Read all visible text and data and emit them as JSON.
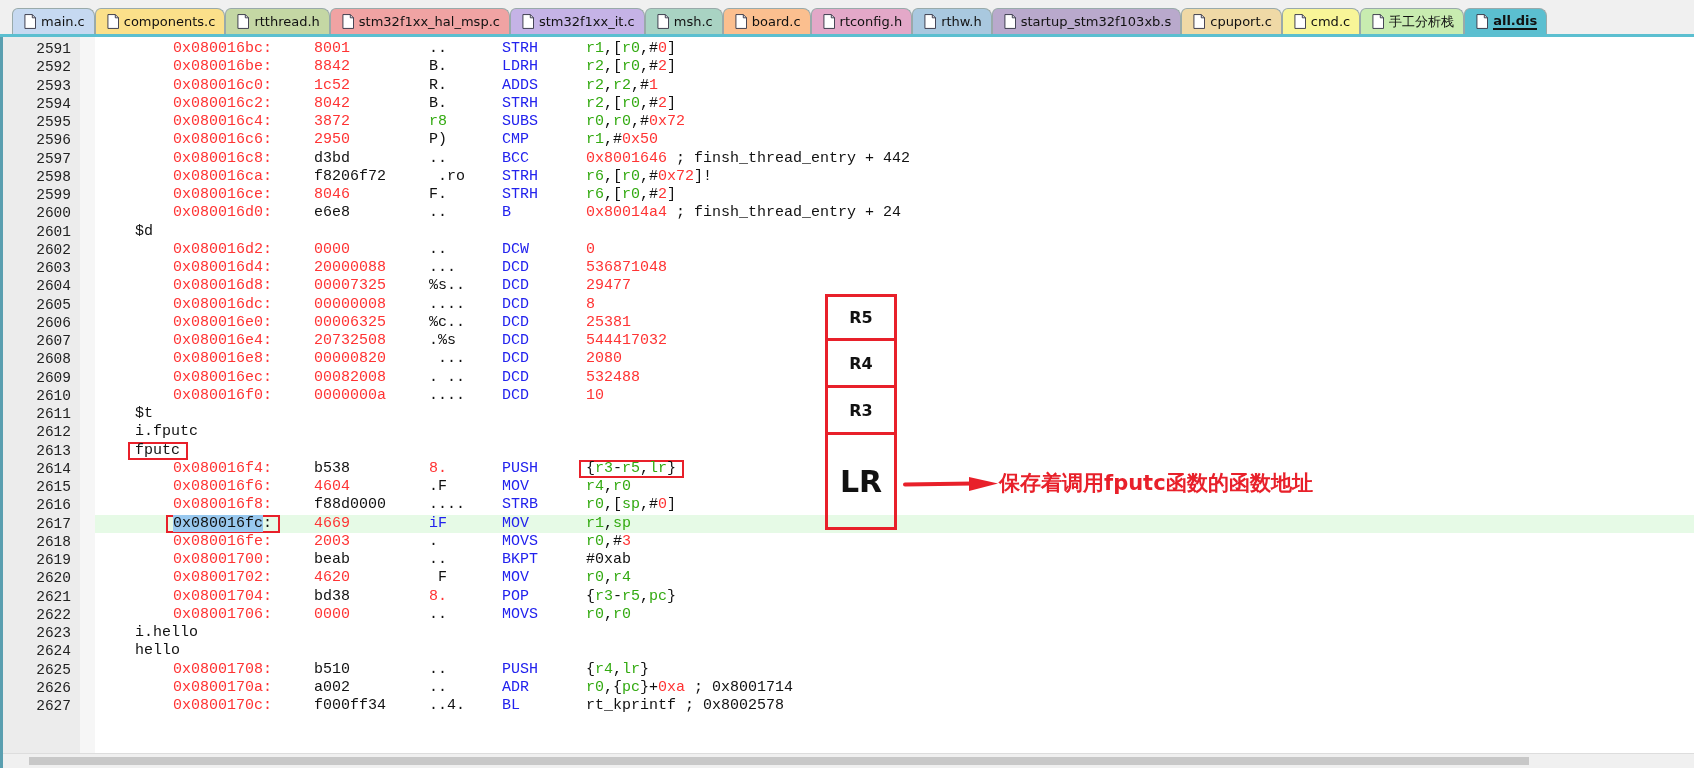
{
  "tabs": [
    {
      "label": "main.c",
      "color": "#c6d9f1",
      "selected": false
    },
    {
      "label": "components.c",
      "color": "#fbe08a",
      "selected": false
    },
    {
      "label": "rtthread.h",
      "color": "#c4d7a4",
      "selected": false
    },
    {
      "label": "stm32f1xx_hal_msp.c",
      "color": "#f0a3a3",
      "selected": false
    },
    {
      "label": "stm32f1xx_it.c",
      "color": "#c5b3e6",
      "selected": false
    },
    {
      "label": "msh.c",
      "color": "#a9d3c3",
      "selected": false
    },
    {
      "label": "board.c",
      "color": "#fbbf8f",
      "selected": false
    },
    {
      "label": "rtconfig.h",
      "color": "#e3a8c8",
      "selected": false
    },
    {
      "label": "rthw.h",
      "color": "#a9c8df",
      "selected": false
    },
    {
      "label": "startup_stm32f103xb.s",
      "color": "#b9a9cc",
      "selected": false
    },
    {
      "label": "cpuport.c",
      "color": "#efd9a6",
      "selected": false
    },
    {
      "label": "cmd.c",
      "color": "#f8f598",
      "selected": false
    },
    {
      "label": "手工分析栈",
      "color": "#c8ecb0",
      "selected": false
    },
    {
      "label": "all.dis",
      "color": "#5bbfd0",
      "selected": true
    }
  ],
  "lines": [
    {
      "num": "2591",
      "kind": "instr",
      "addr": "0x080016bc:",
      "hex": {
        "text": "8001",
        "kind": "num"
      },
      "ascii": {
        "text": "..",
        "kind": "txt"
      },
      "op": "STRH",
      "args": [
        {
          "text": "r1",
          "kind": "reg"
        },
        {
          "text": ",[",
          "kind": "txt"
        },
        {
          "text": "r0",
          "kind": "reg"
        },
        {
          "text": ",#",
          "kind": "txt"
        },
        {
          "text": "0",
          "kind": "num"
        },
        {
          "text": "]",
          "kind": "txt"
        }
      ]
    },
    {
      "num": "2592",
      "kind": "instr",
      "addr": "0x080016be:",
      "hex": {
        "text": "8842",
        "kind": "num"
      },
      "ascii": {
        "text": "B.",
        "kind": "txt"
      },
      "op": "LDRH",
      "args": [
        {
          "text": "r2",
          "kind": "reg"
        },
        {
          "text": ",[",
          "kind": "txt"
        },
        {
          "text": "r0",
          "kind": "reg"
        },
        {
          "text": ",#",
          "kind": "txt"
        },
        {
          "text": "2",
          "kind": "num"
        },
        {
          "text": "]",
          "kind": "txt"
        }
      ]
    },
    {
      "num": "2593",
      "kind": "instr",
      "addr": "0x080016c0:",
      "hex": {
        "text": "1c52",
        "kind": "num"
      },
      "ascii": {
        "text": "R.",
        "kind": "txt"
      },
      "op": "ADDS",
      "args": [
        {
          "text": "r2",
          "kind": "reg"
        },
        {
          "text": ",",
          "kind": "txt"
        },
        {
          "text": "r2",
          "kind": "reg"
        },
        {
          "text": ",#",
          "kind": "txt"
        },
        {
          "text": "1",
          "kind": "num"
        }
      ]
    },
    {
      "num": "2594",
      "kind": "instr",
      "addr": "0x080016c2:",
      "hex": {
        "text": "8042",
        "kind": "num"
      },
      "ascii": {
        "text": "B.",
        "kind": "txt"
      },
      "op": "STRH",
      "args": [
        {
          "text": "r2",
          "kind": "reg"
        },
        {
          "text": ",[",
          "kind": "txt"
        },
        {
          "text": "r0",
          "kind": "reg"
        },
        {
          "text": ",#",
          "kind": "txt"
        },
        {
          "text": "2",
          "kind": "num"
        },
        {
          "text": "]",
          "kind": "txt"
        }
      ]
    },
    {
      "num": "2595",
      "kind": "instr",
      "addr": "0x080016c4:",
      "hex": {
        "text": "3872",
        "kind": "num"
      },
      "ascii": {
        "text": "r8",
        "kind": "reg"
      },
      "op": "SUBS",
      "args": [
        {
          "text": "r0",
          "kind": "reg"
        },
        {
          "text": ",",
          "kind": "txt"
        },
        {
          "text": "r0",
          "kind": "reg"
        },
        {
          "text": ",#",
          "kind": "txt"
        },
        {
          "text": "0x72",
          "kind": "num"
        }
      ]
    },
    {
      "num": "2596",
      "kind": "instr",
      "addr": "0x080016c6:",
      "hex": {
        "text": "2950",
        "kind": "num"
      },
      "ascii": {
        "text": "P)",
        "kind": "txt"
      },
      "op": "CMP",
      "args": [
        {
          "text": "r1",
          "kind": "reg"
        },
        {
          "text": ",#",
          "kind": "txt"
        },
        {
          "text": "0x50",
          "kind": "num"
        }
      ]
    },
    {
      "num": "2597",
      "kind": "instr",
      "addr": "0x080016c8:",
      "hex": {
        "text": "d3bd",
        "kind": "txt"
      },
      "ascii": {
        "text": "..",
        "kind": "txt"
      },
      "op": "BCC",
      "args": [
        {
          "text": "0x8001646",
          "kind": "num"
        },
        {
          "text": " ; finsh_thread_entry + 442",
          "kind": "txt"
        }
      ]
    },
    {
      "num": "2598",
      "kind": "instr",
      "addr": "0x080016ca:",
      "hex": {
        "text": "f8206f72",
        "kind": "txt"
      },
      "ascii": {
        "text": " .ro",
        "kind": "txt"
      },
      "op": "STRH",
      "args": [
        {
          "text": "r6",
          "kind": "reg"
        },
        {
          "text": ",[",
          "kind": "txt"
        },
        {
          "text": "r0",
          "kind": "reg"
        },
        {
          "text": ",#",
          "kind": "txt"
        },
        {
          "text": "0x72",
          "kind": "num"
        },
        {
          "text": "]!",
          "kind": "txt"
        }
      ]
    },
    {
      "num": "2599",
      "kind": "instr",
      "addr": "0x080016ce:",
      "hex": {
        "text": "8046",
        "kind": "num"
      },
      "ascii": {
        "text": "F.",
        "kind": "txt"
      },
      "op": "STRH",
      "args": [
        {
          "text": "r6",
          "kind": "reg"
        },
        {
          "text": ",[",
          "kind": "txt"
        },
        {
          "text": "r0",
          "kind": "reg"
        },
        {
          "text": ",#",
          "kind": "txt"
        },
        {
          "text": "2",
          "kind": "num"
        },
        {
          "text": "]",
          "kind": "txt"
        }
      ]
    },
    {
      "num": "2600",
      "kind": "instr",
      "addr": "0x080016d0:",
      "hex": {
        "text": "e6e8",
        "kind": "txt"
      },
      "ascii": {
        "text": "..",
        "kind": "txt"
      },
      "op": "B",
      "args": [
        {
          "text": "0x80014a4",
          "kind": "num"
        },
        {
          "text": " ; finsh_thread_entry + 24",
          "kind": "txt"
        }
      ]
    },
    {
      "num": "2601",
      "kind": "label",
      "text": "$d"
    },
    {
      "num": "2602",
      "kind": "instr",
      "addr": "0x080016d2:",
      "hex": {
        "text": "0000",
        "kind": "num"
      },
      "ascii": {
        "text": "..",
        "kind": "txt"
      },
      "op": "DCW",
      "args": [
        {
          "text": "0",
          "kind": "num"
        }
      ]
    },
    {
      "num": "2603",
      "kind": "instr",
      "addr": "0x080016d4:",
      "hex": {
        "text": "20000088",
        "kind": "num"
      },
      "ascii": {
        "text": "...",
        "kind": "txt"
      },
      "op": "DCD",
      "args": [
        {
          "text": "536871048",
          "kind": "num"
        }
      ]
    },
    {
      "num": "2604",
      "kind": "instr",
      "addr": "0x080016d8:",
      "hex": {
        "text": "00007325",
        "kind": "num"
      },
      "ascii": {
        "text": "%s..",
        "kind": "txt"
      },
      "op": "DCD",
      "args": [
        {
          "text": "29477",
          "kind": "num"
        }
      ]
    },
    {
      "num": "2605",
      "kind": "instr",
      "addr": "0x080016dc:",
      "hex": {
        "text": "00000008",
        "kind": "num"
      },
      "ascii": {
        "text": "....",
        "kind": "txt"
      },
      "op": "DCD",
      "args": [
        {
          "text": "8",
          "kind": "num"
        }
      ]
    },
    {
      "num": "2606",
      "kind": "instr",
      "addr": "0x080016e0:",
      "hex": {
        "text": "00006325",
        "kind": "num"
      },
      "ascii": {
        "text": "%c..",
        "kind": "txt"
      },
      "op": "DCD",
      "args": [
        {
          "text": "25381",
          "kind": "num"
        }
      ]
    },
    {
      "num": "2607",
      "kind": "instr",
      "addr": "0x080016e4:",
      "hex": {
        "text": "20732508",
        "kind": "num"
      },
      "ascii": {
        "text": ".%s",
        "kind": "txt"
      },
      "op": "DCD",
      "args": [
        {
          "text": "544417032",
          "kind": "num"
        }
      ]
    },
    {
      "num": "2608",
      "kind": "instr",
      "addr": "0x080016e8:",
      "hex": {
        "text": "00000820",
        "kind": "num"
      },
      "ascii": {
        "text": " ...",
        "kind": "txt"
      },
      "op": "DCD",
      "args": [
        {
          "text": "2080",
          "kind": "num"
        }
      ]
    },
    {
      "num": "2609",
      "kind": "instr",
      "addr": "0x080016ec:",
      "hex": {
        "text": "00082008",
        "kind": "num"
      },
      "ascii": {
        "text": ". ..",
        "kind": "txt"
      },
      "op": "DCD",
      "args": [
        {
          "text": "532488",
          "kind": "num"
        }
      ]
    },
    {
      "num": "2610",
      "kind": "instr",
      "addr": "0x080016f0:",
      "hex": {
        "text": "0000000a",
        "kind": "num"
      },
      "ascii": {
        "text": "....",
        "kind": "txt"
      },
      "op": "DCD",
      "args": [
        {
          "text": "10",
          "kind": "num"
        }
      ]
    },
    {
      "num": "2611",
      "kind": "label",
      "text": "$t"
    },
    {
      "num": "2612",
      "kind": "label",
      "text": "i.fputc"
    },
    {
      "num": "2613",
      "kind": "label",
      "text": "fputc",
      "boxed": true
    },
    {
      "num": "2614",
      "kind": "instr",
      "addr": "0x080016f4:",
      "hex": {
        "text": "b538",
        "kind": "txt"
      },
      "ascii": {
        "text": "8.",
        "kind": "num"
      },
      "op": "PUSH",
      "args": [
        {
          "text": "{",
          "kind": "txt"
        },
        {
          "text": "r3",
          "kind": "reg"
        },
        {
          "text": "-",
          "kind": "txt"
        },
        {
          "text": "r5",
          "kind": "reg"
        },
        {
          "text": ",",
          "kind": "txt"
        },
        {
          "text": "lr",
          "kind": "reg"
        },
        {
          "text": "}",
          "kind": "txt"
        }
      ],
      "args_boxed": true
    },
    {
      "num": "2615",
      "kind": "instr",
      "addr": "0x080016f6:",
      "hex": {
        "text": "4604",
        "kind": "num"
      },
      "ascii": {
        "text": ".F",
        "kind": "txt"
      },
      "op": "MOV",
      "args": [
        {
          "text": "r4",
          "kind": "reg"
        },
        {
          "text": ",",
          "kind": "txt"
        },
        {
          "text": "r0",
          "kind": "reg"
        }
      ]
    },
    {
      "num": "2616",
      "kind": "instr",
      "addr": "0x080016f8:",
      "hex": {
        "text": "f88d0000",
        "kind": "txt"
      },
      "ascii": {
        "text": "....",
        "kind": "txt"
      },
      "op": "STRB",
      "args": [
        {
          "text": "r0",
          "kind": "reg"
        },
        {
          "text": ",[",
          "kind": "txt"
        },
        {
          "text": "sp",
          "kind": "reg"
        },
        {
          "text": ",#",
          "kind": "txt"
        },
        {
          "text": "0",
          "kind": "num"
        },
        {
          "text": "]",
          "kind": "txt"
        }
      ]
    },
    {
      "num": "2617",
      "kind": "instr",
      "addr": "0x080016fc:",
      "hex": {
        "text": "4669",
        "kind": "num"
      },
      "ascii": {
        "text": "iF",
        "kind": "kw"
      },
      "op": "MOV",
      "args": [
        {
          "text": "r1",
          "kind": "reg"
        },
        {
          "text": ",",
          "kind": "txt"
        },
        {
          "text": "sp",
          "kind": "reg"
        }
      ],
      "current": true,
      "addr_selected": true,
      "addr_boxed": true
    },
    {
      "num": "2618",
      "kind": "instr",
      "addr": "0x080016fe:",
      "hex": {
        "text": "2003",
        "kind": "num"
      },
      "ascii": {
        "text": ".",
        "kind": "txt"
      },
      "op": "MOVS",
      "args": [
        {
          "text": "r0",
          "kind": "reg"
        },
        {
          "text": ",#",
          "kind": "txt"
        },
        {
          "text": "3",
          "kind": "num"
        }
      ]
    },
    {
      "num": "2619",
      "kind": "instr",
      "addr": "0x08001700:",
      "hex": {
        "text": "beab",
        "kind": "txt"
      },
      "ascii": {
        "text": "..",
        "kind": "txt"
      },
      "op": "BKPT",
      "args": [
        {
          "text": "#0xab",
          "kind": "txt"
        }
      ]
    },
    {
      "num": "2620",
      "kind": "instr",
      "addr": "0x08001702:",
      "hex": {
        "text": "4620",
        "kind": "num"
      },
      "ascii": {
        "text": " F",
        "kind": "txt"
      },
      "op": "MOV",
      "args": [
        {
          "text": "r0",
          "kind": "reg"
        },
        {
          "text": ",",
          "kind": "txt"
        },
        {
          "text": "r4",
          "kind": "reg"
        }
      ]
    },
    {
      "num": "2621",
      "kind": "instr",
      "addr": "0x08001704:",
      "hex": {
        "text": "bd38",
        "kind": "txt"
      },
      "ascii": {
        "text": "8.",
        "kind": "num"
      },
      "op": "POP",
      "args": [
        {
          "text": "{",
          "kind": "txt"
        },
        {
          "text": "r3",
          "kind": "reg"
        },
        {
          "text": "-",
          "kind": "txt"
        },
        {
          "text": "r5",
          "kind": "reg"
        },
        {
          "text": ",",
          "kind": "txt"
        },
        {
          "text": "pc",
          "kind": "reg"
        },
        {
          "text": "}",
          "kind": "txt"
        }
      ]
    },
    {
      "num": "2622",
      "kind": "instr",
      "addr": "0x08001706:",
      "hex": {
        "text": "0000",
        "kind": "num"
      },
      "ascii": {
        "text": "..",
        "kind": "txt"
      },
      "op": "MOVS",
      "args": [
        {
          "text": "r0",
          "kind": "reg"
        },
        {
          "text": ",",
          "kind": "txt"
        },
        {
          "text": "r0",
          "kind": "reg"
        }
      ]
    },
    {
      "num": "2623",
      "kind": "label",
      "text": "i.hello"
    },
    {
      "num": "2624",
      "kind": "label",
      "text": "hello"
    },
    {
      "num": "2625",
      "kind": "instr",
      "addr": "0x08001708:",
      "hex": {
        "text": "b510",
        "kind": "txt"
      },
      "ascii": {
        "text": "..",
        "kind": "txt"
      },
      "op": "PUSH",
      "args": [
        {
          "text": "{",
          "kind": "txt"
        },
        {
          "text": "r4",
          "kind": "reg"
        },
        {
          "text": ",",
          "kind": "txt"
        },
        {
          "text": "lr",
          "kind": "reg"
        },
        {
          "text": "}",
          "kind": "txt"
        }
      ]
    },
    {
      "num": "2626",
      "kind": "instr",
      "addr": "0x0800170a:",
      "hex": {
        "text": "a002",
        "kind": "txt"
      },
      "ascii": {
        "text": "..",
        "kind": "txt"
      },
      "op": "ADR",
      "args": [
        {
          "text": "r0",
          "kind": "reg"
        },
        {
          "text": ",{",
          "kind": "txt"
        },
        {
          "text": "pc",
          "kind": "reg"
        },
        {
          "text": "}+",
          "kind": "txt"
        },
        {
          "text": "0xa",
          "kind": "num"
        },
        {
          "text": " ; 0x8001714",
          "kind": "txt"
        }
      ]
    },
    {
      "num": "2627",
      "kind": "instr",
      "addr": "0x0800170c:",
      "hex": {
        "text": "f000ff34",
        "kind": "txt"
      },
      "ascii": {
        "text": "..4.",
        "kind": "txt"
      },
      "op": "BL",
      "args": [
        {
          "text": "rt_kprintf ; 0x8002578",
          "kind": "txt"
        }
      ]
    }
  ],
  "stack": {
    "slots": [
      {
        "label": "R5",
        "kind": "small"
      },
      {
        "label": "R4",
        "kind": "small"
      },
      {
        "label": "R3",
        "kind": "small"
      },
      {
        "label": "LR",
        "kind": "large"
      }
    ],
    "note": "保存着调用fputc函数的函数地址"
  }
}
